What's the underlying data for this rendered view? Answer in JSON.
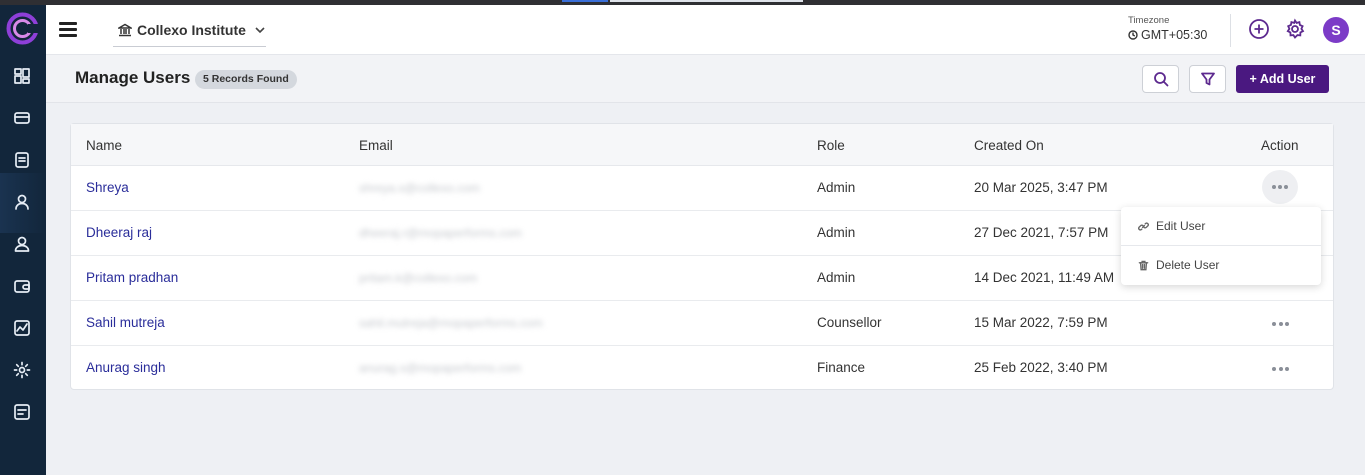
{
  "header": {
    "institute_name": "Collexo Institute",
    "timezone_title": "Timezone",
    "timezone_value": "GMT+05:30",
    "avatar_initial": "S"
  },
  "page": {
    "title": "Manage Users",
    "records_badge": "5 Records Found",
    "add_user_label": "+ Add User"
  },
  "table": {
    "columns": [
      "Name",
      "Email",
      "Role",
      "Created On",
      "Action"
    ],
    "rows": [
      {
        "name": "Shreya",
        "email": "shreya.s@collexo.com",
        "role": "Admin",
        "created_on": "20 Mar 2025, 3:47 PM"
      },
      {
        "name": "Dheeraj raj",
        "email": "dheeraj.r@mopaperforms.com",
        "role": "Admin",
        "created_on": "27 Dec 2021, 7:57 PM"
      },
      {
        "name": "Pritam pradhan",
        "email": "pritam.k@collexo.com",
        "role": "Admin",
        "created_on": "14 Dec 2021, 11:49 AM"
      },
      {
        "name": "Sahil mutreja",
        "email": "sahil.mutreja@mopaperforms.com",
        "role": "Counsellor",
        "created_on": "15 Mar 2022, 7:59 PM"
      },
      {
        "name": "Anurag singh",
        "email": "anurag.s@mopaperforms.com",
        "role": "Finance",
        "created_on": "25 Feb 2022, 3:40 PM"
      }
    ]
  },
  "action_menu": {
    "edit_label": "Edit User",
    "delete_label": "Delete User"
  },
  "colors": {
    "brand": "#4a1880",
    "accent": "#5d2a8f",
    "rail": "#12263b",
    "link": "#2a2d9a"
  },
  "icons": [
    "collexo-logo-icon",
    "dashboard-icon",
    "card-icon",
    "document-icon",
    "user-icon",
    "user-badge-icon",
    "wallet-icon",
    "chart-icon",
    "gear-icon",
    "notes-icon",
    "hamburger-icon",
    "institution-icon",
    "chevron-down-icon",
    "clock-icon",
    "plus-circle-icon",
    "settings-icon",
    "search-icon",
    "filter-icon",
    "link-icon",
    "trash-icon",
    "more-icon"
  ]
}
